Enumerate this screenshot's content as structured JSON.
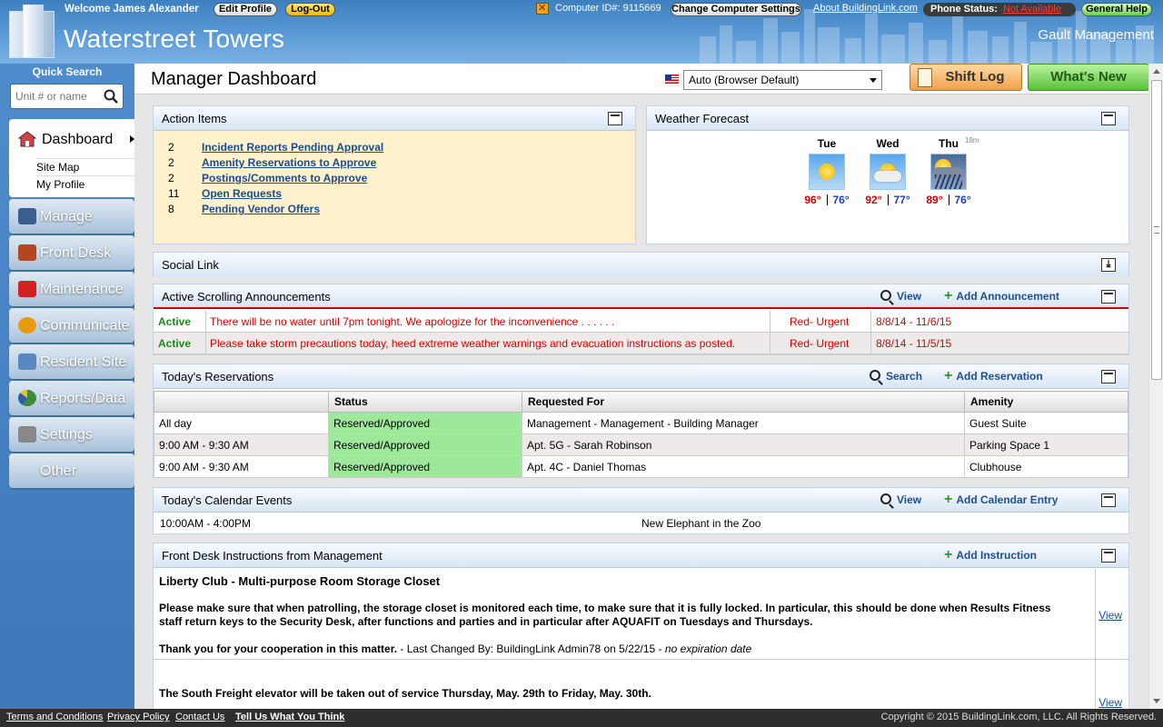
{
  "header": {
    "welcome": "Welcome  James Alexander",
    "edit_profile": "Edit Profile",
    "logout": "Log-Out",
    "computer_id": "Computer ID#:  9115669",
    "change_settings": "Change Computer Settings",
    "about": "About BuildingLink.com",
    "phone_status_label": "Phone Status:",
    "phone_status_value": "Not Available",
    "general_help": "General Help",
    "site_title": "Waterstreet Towers",
    "company": "Gault Management"
  },
  "sidebar": {
    "quick_search_title": "Quick Search",
    "quick_search_placeholder": "Unit # or name",
    "dashboard": "Dashboard",
    "sub": [
      "Site Map",
      "My Profile"
    ],
    "items": [
      {
        "label": "Manage",
        "icon": "person-icon",
        "color": "#3a5f8f"
      },
      {
        "label": "Front Desk",
        "icon": "desk-icon",
        "color": "#b3471f"
      },
      {
        "label": "Maintenance",
        "icon": "toolbox-icon",
        "color": "#d32020"
      },
      {
        "label": "Communicate",
        "icon": "broadcast-icon",
        "color": "#e89a10"
      },
      {
        "label": "Resident Site",
        "icon": "monitor-icon",
        "color": "#5a89c0"
      },
      {
        "label": "Reports/Data",
        "icon": "pie-chart-icon",
        "color": "#3a8a3a"
      },
      {
        "label": "Settings",
        "icon": "tools-icon",
        "color": "#888888"
      },
      {
        "label": "Other",
        "icon": "",
        "color": ""
      }
    ]
  },
  "topbar": {
    "title": "Manager Dashboard",
    "language": "Auto (Browser Default)",
    "shift_log": "Shift Log",
    "whats_new": "What's New"
  },
  "action_items": {
    "title": "Action Items",
    "rows": [
      {
        "count": "2",
        "label": "Incident Reports Pending Approval"
      },
      {
        "count": "2",
        "label": "Amenity Reservations to Approve"
      },
      {
        "count": "2",
        "label": "Postings/Comments to Approve"
      },
      {
        "count": "11",
        "label": "Open Requests"
      },
      {
        "count": "8",
        "label": "Pending Vendor Offers"
      }
    ]
  },
  "weather": {
    "title": "Weather Forecast",
    "tiny": "18m",
    "days": [
      {
        "day": "Tue",
        "hi": "96°",
        "lo": "76°",
        "icon": "sunny-icon"
      },
      {
        "day": "Wed",
        "hi": "92°",
        "lo": "77°",
        "icon": "partly-cloudy-icon"
      },
      {
        "day": "Thu",
        "hi": "89°",
        "lo": "76°",
        "icon": "storm-icon"
      }
    ]
  },
  "social": {
    "title": "Social Link"
  },
  "announcements": {
    "title": "Active Scrolling Announcements",
    "view": "View",
    "add": "Add Announcement",
    "rows": [
      {
        "status": "Active",
        "message": "There will be no water until 7pm tonight. We apologize for the inconvenience . . . . . .",
        "priority": "Red- Urgent",
        "dates": "8/8/14 - 11/6/15"
      },
      {
        "status": "Active",
        "message": "Please take storm precautions today, heed extreme weather warnings and evacuation instructions as posted.",
        "priority": "Red- Urgent",
        "dates": "8/8/14 - 11/5/15"
      }
    ]
  },
  "reservations": {
    "title": "Today's Reservations",
    "search": "Search",
    "add": "Add Reservation",
    "columns": [
      "",
      "Status",
      "Requested For",
      "Amenity"
    ],
    "rows": [
      [
        "All day",
        "Reserved/Approved",
        "Management - Management - Building Manager",
        "Guest Suite"
      ],
      [
        "9:00 AM - 9:30 AM",
        "Reserved/Approved",
        "Apt. 5G - Sarah Robinson",
        "Parking Space 1"
      ],
      [
        "9:00 AM - 9:30 AM",
        "Reserved/Approved",
        "Apt. 4C - Daniel Thomas",
        "Clubhouse"
      ]
    ]
  },
  "calendar": {
    "title": "Today's Calendar Events",
    "view": "View",
    "add": "Add Calendar Entry",
    "rows": [
      {
        "time": "10:00AM - 4:00PM",
        "event": "New Elephant in the Zoo"
      }
    ]
  },
  "front_desk": {
    "title": "Front Desk Instructions from Management",
    "add": "Add Instruction",
    "items": [
      {
        "heading": "Liberty Club - Multi-purpose Room Storage Closet",
        "body": "Please make sure that when patrolling, the storage closet is monitored each time, to make sure that it is fully locked. In particular, this should be done when Results Fitness staff return keys to the Security Desk, after functions and parties and in particular after AQUAFIT on Tuesdays and Thursdays.",
        "thanks": "Thank you for your cooperation in this matter.",
        "changed": " - Last Changed By: BuildingLink Admin78 on 5/22/15 - ",
        "expiry": "no expiration date",
        "view": "View"
      },
      {
        "body": "The South Freight elevator will be taken out of service Thursday, May. 29th  to Friday, May. 30th.",
        "view": "View"
      }
    ]
  },
  "footer": {
    "links": [
      "Terms and Conditions",
      "Privacy Policy",
      "Contact Us",
      "Tell Us What You Think"
    ],
    "copyright": "Copyright © 2015 BuildingLink.com, LLC.   All Rights Reserved."
  }
}
